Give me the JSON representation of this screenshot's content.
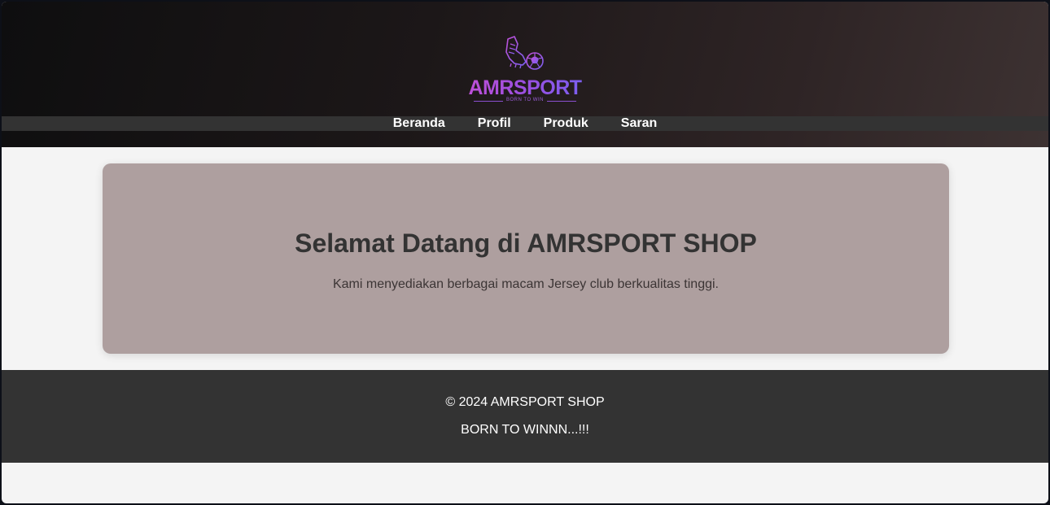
{
  "header": {
    "brand": "AMRSPORT",
    "brand_tagline": "BORN TO WIN",
    "logo_icon": "football-boot-ball-icon"
  },
  "nav": {
    "items": [
      {
        "label": "Beranda"
      },
      {
        "label": "Profil"
      },
      {
        "label": "Produk"
      },
      {
        "label": "Saran"
      }
    ]
  },
  "hero": {
    "title": "Selamat Datang di AMRSPORT SHOP",
    "description": "Kami menyediakan berbagai macam Jersey club berkualitas tinggi."
  },
  "footer": {
    "copyright": "© 2024 AMRSPORT SHOP",
    "tagline": "BORN TO WINNN...!!!"
  },
  "colors": {
    "nav_bar": "#333333",
    "hero_bg": "#ae9f9f",
    "footer_bg": "#333333",
    "page_bg": "#f4f4f4",
    "brand_gradient_start": "#c050d8",
    "brand_gradient_end": "#7b5ff0"
  }
}
